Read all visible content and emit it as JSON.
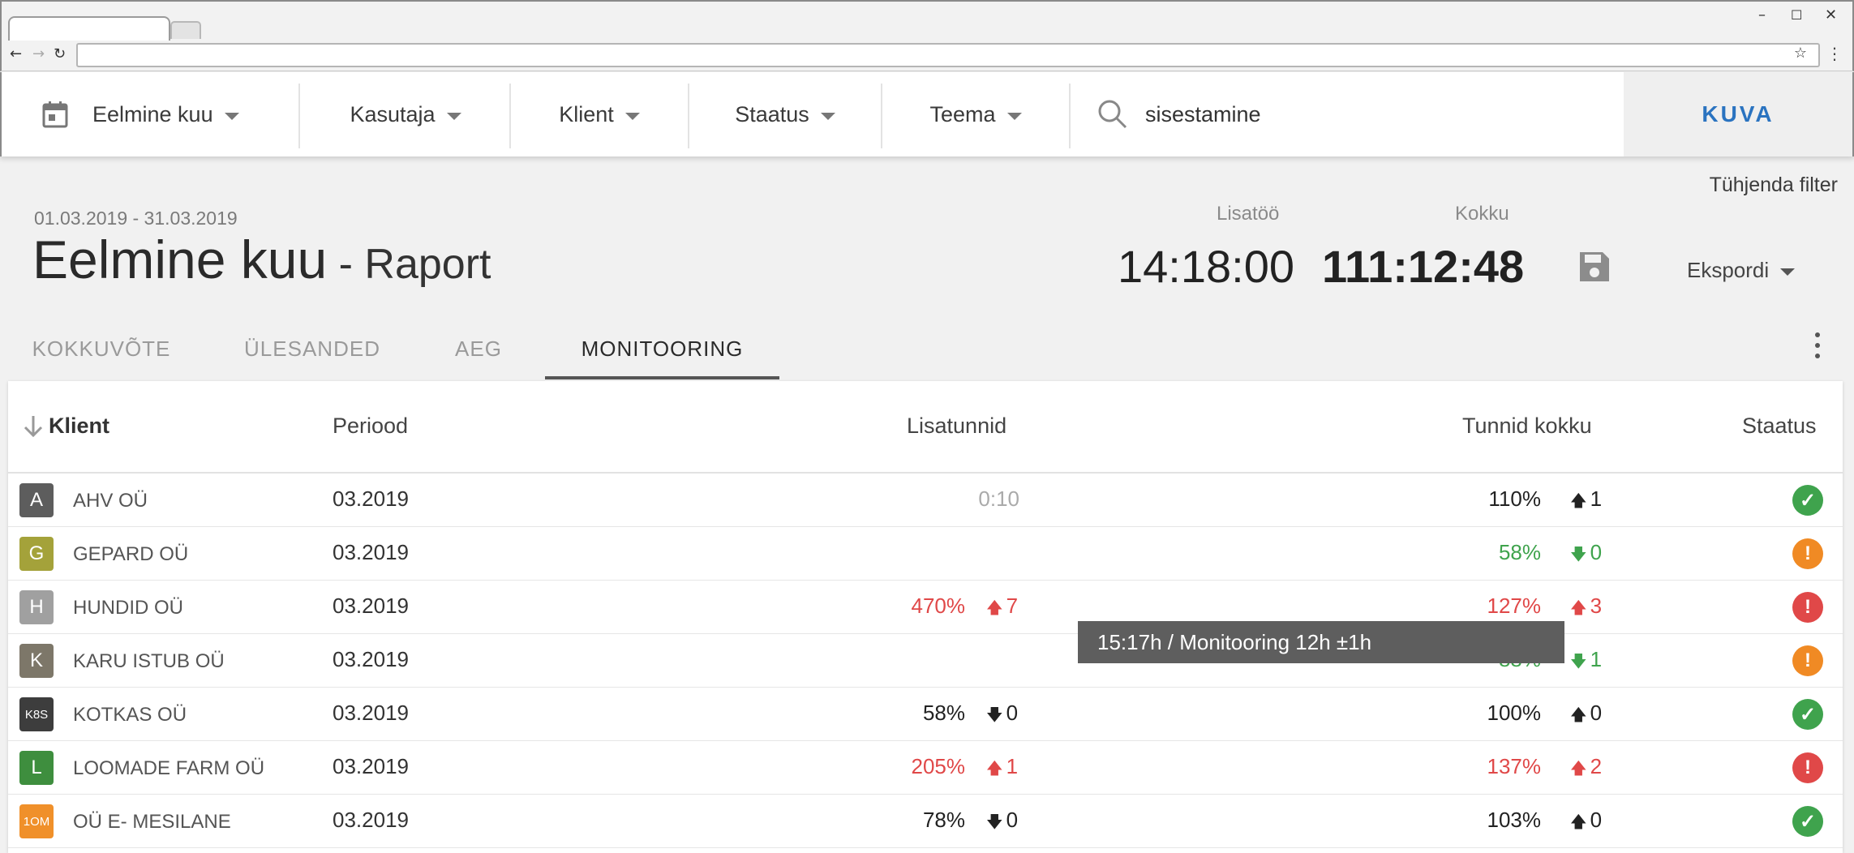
{
  "filters": {
    "period": "Eelmine kuu",
    "user": "Kasutaja",
    "client": "Klient",
    "status": "Staatus",
    "theme": "Teema",
    "search_value": "sisestamine",
    "show_button": "KUVA"
  },
  "header": {
    "clear_filter": "Tühjenda filter",
    "date_range": "01.03.2019 - 31.03.2019",
    "title_main": "Eelmine kuu",
    "title_sub": " - Raport",
    "overtime_label": "Lisatöö",
    "overtime_value": "14:18:00",
    "total_label": "Kokku",
    "total_value": "111:12:48",
    "export_label": "Ekspordi"
  },
  "tabs": [
    {
      "label": "KOKKUVÕTE"
    },
    {
      "label": "ÜLESANDED"
    },
    {
      "label": "AEG"
    },
    {
      "label": "MONITOORING"
    }
  ],
  "table": {
    "columns": {
      "client": "Klient",
      "period": "Periood",
      "overtime": "Lisatunnid",
      "total": "Tunnid kokku",
      "status": "Staatus"
    },
    "rows": [
      {
        "avatar": "A",
        "avatar_color": "#5d5d5d",
        "name": "AHV OÜ",
        "period": "03.2019",
        "overtime_pct": "0:10",
        "overtime_trend": "",
        "total_pct": "110%",
        "total_trend": "1",
        "total_dir": "up",
        "status": "ok"
      },
      {
        "avatar": "G",
        "avatar_color": "#a4a23a",
        "name": "GEPARD OÜ",
        "period": "03.2019",
        "overtime_pct": "",
        "overtime_trend": "",
        "total_pct": "58%",
        "total_trend": "0",
        "total_dir": "down",
        "status": "warn"
      },
      {
        "avatar": "H",
        "avatar_color": "#a0a0a0",
        "name": "HUNDID OÜ",
        "period": "03.2019",
        "overtime_pct": "470%",
        "overtime_trend": "7",
        "total_pct": "127%",
        "total_trend": "3",
        "total_dir": "up",
        "status": "error"
      },
      {
        "avatar": "K",
        "avatar_color": "#7d7769",
        "name": "KARU ISTUB OÜ",
        "period": "03.2019",
        "overtime_pct": "",
        "overtime_trend": "",
        "total_pct": "88%",
        "total_trend": "1",
        "total_dir": "down",
        "status": "warn"
      },
      {
        "avatar": "K8S",
        "avatar_color": "#3d3d3d",
        "name": "KOTKAS OÜ",
        "period": "03.2019",
        "overtime_pct": "58%",
        "overtime_trend": "0",
        "total_pct": "100%",
        "total_trend": "0",
        "total_dir": "up",
        "status": "ok"
      },
      {
        "avatar": "L",
        "avatar_color": "#3e8e3e",
        "name": "LOOMADE FARM OÜ",
        "period": "03.2019",
        "overtime_pct": "205%",
        "overtime_trend": "1",
        "total_pct": "137%",
        "total_trend": "2",
        "total_dir": "up",
        "status": "error"
      },
      {
        "avatar": "1OM",
        "avatar_color": "#f0902a",
        "name": "OÜ E- MESILANE",
        "period": "03.2019",
        "overtime_pct": "78%",
        "overtime_trend": "0",
        "total_pct": "103%",
        "total_trend": "0",
        "total_dir": "up",
        "status": "ok"
      }
    ]
  },
  "tooltip": "15:17h / Monitooring 12h ±1h",
  "colors": {
    "accent": "#2a73c0",
    "ok": "#3fa34d",
    "warn": "#f08a24",
    "error": "#e04848"
  }
}
